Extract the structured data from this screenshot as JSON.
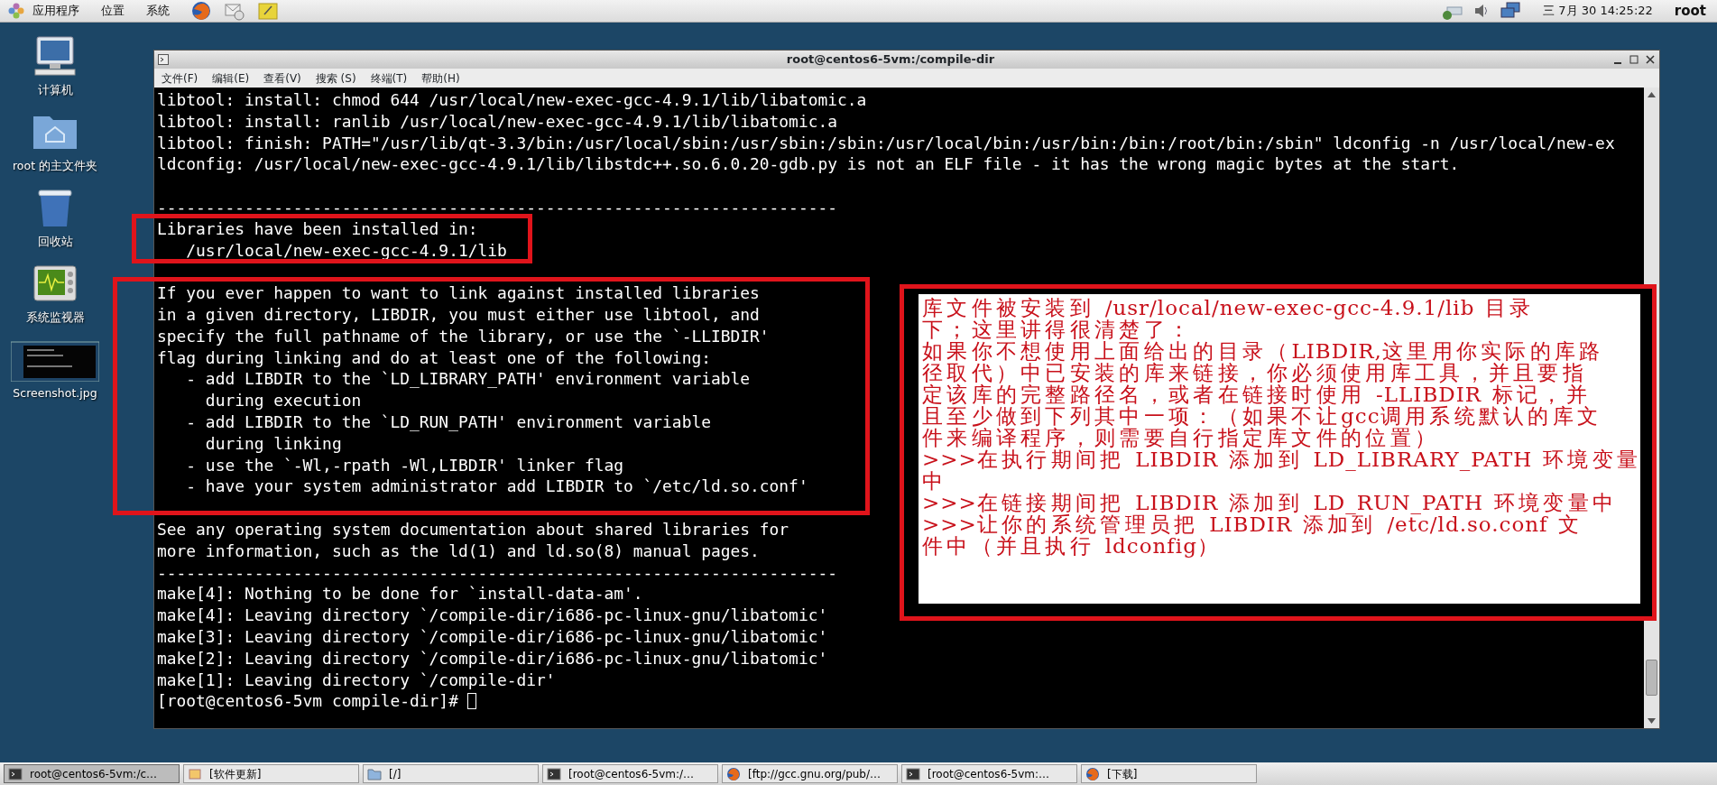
{
  "top_panel": {
    "menus": [
      {
        "label": "应用程序"
      },
      {
        "label": "位置"
      },
      {
        "label": "系统"
      }
    ],
    "clock": "三 7月 30 14:25:22",
    "user": "root"
  },
  "desktop_icons": [
    {
      "kind": "computer",
      "label": "计算机"
    },
    {
      "kind": "home",
      "label": "root 的主文件夹"
    },
    {
      "kind": "trash",
      "label": "回收站"
    },
    {
      "kind": "monitor",
      "label": "系统监视器"
    },
    {
      "kind": "image",
      "label": "Screenshot.jpg"
    }
  ],
  "window": {
    "title": "root@centos6-5vm:/compile-dir",
    "menu": [
      "文件(F)",
      "编辑(E)",
      "查看(V)",
      "搜索 (S)",
      "终端(T)",
      "帮助(H)"
    ],
    "blocks": [
      {
        "blank_line_before": false,
        "highlighted": false,
        "lines": [
          "libtool: install: chmod 644 /usr/local/new-exec-gcc-4.9.1/lib/libatomic.a",
          "libtool: install: ranlib /usr/local/new-exec-gcc-4.9.1/lib/libatomic.a",
          "libtool: finish: PATH=\"/usr/lib/qt-3.3/bin:/usr/local/sbin:/usr/sbin:/sbin:/usr/local/bin:/usr/bin:/bin:/root/bin:/sbin\" ldconfig -n /usr/local/new-ex",
          "ldconfig: /usr/local/new-exec-gcc-4.9.1/lib/libstdc++.so.6.0.20-gdb.py is not an ELF file - it has the wrong magic bytes at the start."
        ]
      },
      {
        "blank_line_before": true,
        "highlighted": false,
        "lines": [
          "----------------------------------------------------------------------"
        ]
      },
      {
        "blank_line_before": false,
        "highlighted": true,
        "lines": [
          "Libraries have been installed in:",
          "   /usr/local/new-exec-gcc-4.9.1/lib"
        ]
      },
      {
        "blank_line_before": true,
        "highlighted": true,
        "lines": [
          "If you ever happen to want to link against installed libraries",
          "in a given directory, LIBDIR, you must either use libtool, and",
          "specify the full pathname of the library, or use the `-LLIBDIR'",
          "flag during linking and do at least one of the following:",
          "   - add LIBDIR to the `LD_LIBRARY_PATH' environment variable",
          "     during execution",
          "   - add LIBDIR to the `LD_RUN_PATH' environment variable",
          "     during linking",
          "   - use the `-Wl,-rpath -Wl,LIBDIR' linker flag",
          "   - have your system administrator add LIBDIR to `/etc/ld.so.conf'"
        ]
      },
      {
        "blank_line_before": true,
        "highlighted": false,
        "lines": [
          "See any operating system documentation about shared libraries for",
          "more information, such as the ld(1) and ld.so(8) manual pages.",
          "----------------------------------------------------------------------",
          "make[4]: Nothing to be done for `install-data-am'.",
          "make[4]: Leaving directory `/compile-dir/i686-pc-linux-gnu/libatomic'",
          "make[3]: Leaving directory `/compile-dir/i686-pc-linux-gnu/libatomic'",
          "make[2]: Leaving directory `/compile-dir/i686-pc-linux-gnu/libatomic'",
          "make[1]: Leaving directory `/compile-dir'"
        ]
      }
    ],
    "prompt": "[root@centos6-5vm compile-dir]#"
  },
  "annotation": {
    "lines": [
      "库文件被安装到 /usr/local/new-exec-gcc-4.9.1/lib 目录",
      "下；这里讲得很清楚了：",
      "如果你不想使用上面给出的目录（LIBDIR,这里用你实际的库路",
      "径取代）中已安装的库来链接，你必须使用库工具，并且要指",
      "定该库的完整路径名，或者在链接时使用 -LLIBDIR 标记，并",
      "且至少做到下列其中一项：（如果不让gcc调用系统默认的库文",
      "件来编译程序，则需要自行指定库文件的位置）",
      ">>>在执行期间把 LIBDIR 添加到 LD_LIBRARY_PATH 环境变量",
      "中",
      ">>>在链接期间把 LIBDIR 添加到 LD_RUN_PATH 环境变量中",
      ">>>让你的系统管理员把 LIBDIR 添加到 /etc/ld.so.conf 文",
      "件中（并且执行 ldconfig）"
    ]
  },
  "taskbar": [
    {
      "kind": "terminal",
      "label": "root@centos6-5vm:/c…",
      "selected": true
    },
    {
      "kind": "update",
      "label": "[软件更新]",
      "selected": false
    },
    {
      "kind": "folder",
      "label": "[/]",
      "selected": false
    },
    {
      "kind": "terminal",
      "label": "[root@centos6-5vm:/…",
      "selected": false
    },
    {
      "kind": "browser",
      "label": "[ftp://gcc.gnu.org/pub/…",
      "selected": false
    },
    {
      "kind": "terminal",
      "label": "[root@centos6-5vm:…",
      "selected": false
    },
    {
      "kind": "browser",
      "label": "[下载]",
      "selected": false
    }
  ]
}
